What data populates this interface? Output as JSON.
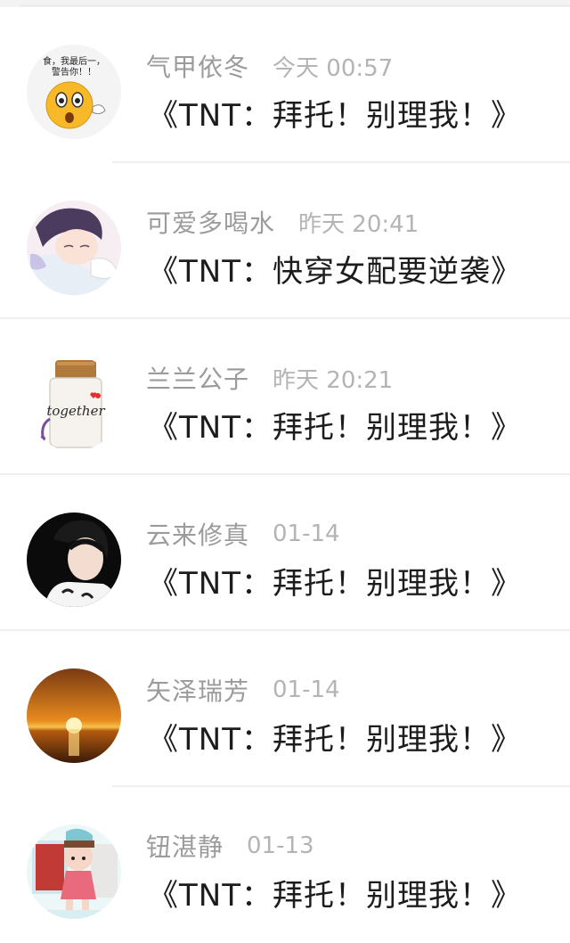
{
  "comments": [
    {
      "name": "气甲依冬",
      "time": "今天 00:57",
      "text": "《TNT：拜托！别理我！》",
      "avatar": "surprised-emoji-avatar",
      "avatar_caption": "食，我最后一，警告你！！"
    },
    {
      "name": "可爱多喝水",
      "time": "昨天 20:41",
      "text": "《TNT：快穿女配要逆袭》",
      "avatar": "anime-character-avatar"
    },
    {
      "name": "兰兰公子",
      "time": "昨天 20:21",
      "text": "《TNT：拜托！别理我！》",
      "avatar": "together-jar-avatar",
      "avatar_caption": "together"
    },
    {
      "name": "云来修真",
      "time": "01-14",
      "text": "《TNT：拜托！别理我！》",
      "avatar": "person-photo-avatar"
    },
    {
      "name": "矢泽瑞芳",
      "time": "01-14",
      "text": "《TNT：拜托！别理我！》",
      "avatar": "sunset-avatar"
    },
    {
      "name": "钮湛静",
      "time": "01-13",
      "text": "《TNT：拜托！别理我！》",
      "avatar": "doll-avatar"
    }
  ],
  "colors": {
    "name": "#9b9b9b",
    "time": "#b4b4b4",
    "text": "#1c1c1c",
    "divider": "#f0f0f0"
  }
}
